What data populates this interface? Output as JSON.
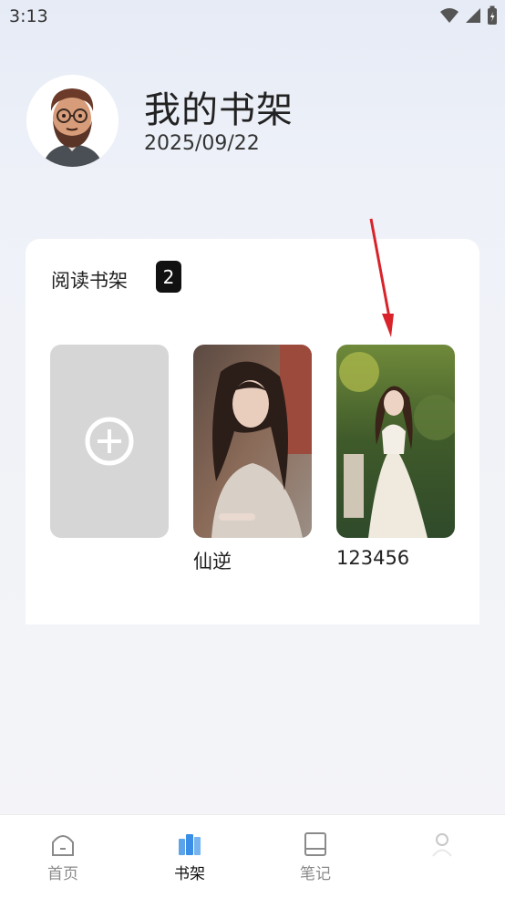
{
  "status_bar": {
    "time": "3:13"
  },
  "header": {
    "title": "我的书架",
    "date": "2025/09/22"
  },
  "shelf": {
    "title": "阅读书架",
    "count": "2",
    "books": [
      {
        "name": "仙逆"
      },
      {
        "name": "123456"
      }
    ]
  },
  "tabs": [
    {
      "label": "首页",
      "icon": "home-icon"
    },
    {
      "label": "书架",
      "icon": "bookshelf-icon"
    },
    {
      "label": "笔记",
      "icon": "notebook-icon"
    },
    {
      "label": "",
      "icon": "profile-icon"
    }
  ],
  "colors": {
    "accent": "#3a8ee6",
    "arrow": "#d9232b"
  }
}
